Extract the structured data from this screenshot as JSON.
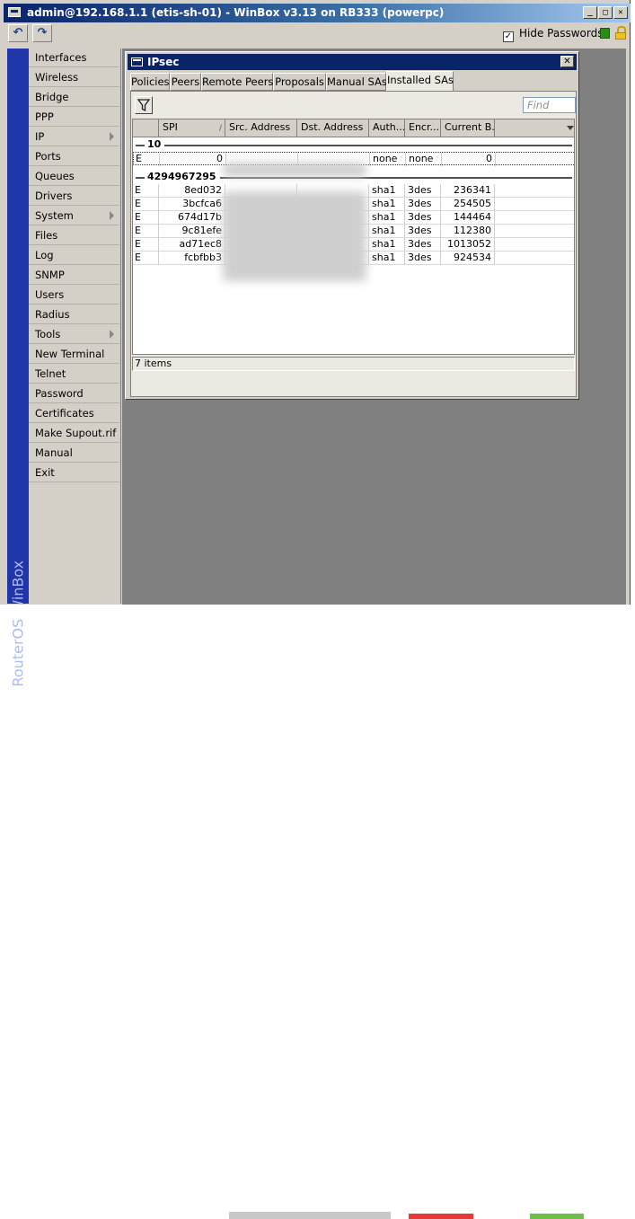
{
  "window": {
    "title": "admin@192.168.1.1 (etis-sh-01) - WinBox v3.13 on RB333 (powerpc)"
  },
  "toolbar": {
    "hide_passwords_label": "Hide Passwords",
    "hide_passwords_checked": "✓"
  },
  "brand": "RouterOS WinBox",
  "menu": {
    "items": [
      {
        "label": "Interfaces",
        "submenu": false
      },
      {
        "label": "Wireless",
        "submenu": false
      },
      {
        "label": "Bridge",
        "submenu": false
      },
      {
        "label": "PPP",
        "submenu": false
      },
      {
        "label": "IP",
        "submenu": true
      },
      {
        "label": "Ports",
        "submenu": false
      },
      {
        "label": "Queues",
        "submenu": false
      },
      {
        "label": "Drivers",
        "submenu": false
      },
      {
        "label": "System",
        "submenu": true
      },
      {
        "label": "Files",
        "submenu": false
      },
      {
        "label": "Log",
        "submenu": false
      },
      {
        "label": "SNMP",
        "submenu": false
      },
      {
        "label": "Users",
        "submenu": false
      },
      {
        "label": "Radius",
        "submenu": false
      },
      {
        "label": "Tools",
        "submenu": true
      },
      {
        "label": "New Terminal",
        "submenu": false
      },
      {
        "label": "Telnet",
        "submenu": false
      },
      {
        "label": "Password",
        "submenu": false
      },
      {
        "label": "Certificates",
        "submenu": false
      },
      {
        "label": "Make Supout.rif",
        "submenu": false
      },
      {
        "label": "Manual",
        "submenu": false
      },
      {
        "label": "Exit",
        "submenu": false
      }
    ]
  },
  "ipsec": {
    "title": "IPsec",
    "tabs": [
      "Policies",
      "Peers",
      "Remote Peers",
      "Proposals",
      "Manual SAs",
      "Installed SAs"
    ],
    "active_tab": "Installed SAs",
    "find_placeholder": "Find",
    "columns": [
      "",
      "SPI",
      "Src. Address",
      "Dst. Address",
      "Auth....",
      "Encr....",
      "Current B..."
    ],
    "groups": [
      {
        "name": "10",
        "rows": [
          {
            "flag": "E",
            "spi": "0",
            "src": "",
            "dst": "",
            "auth": "none",
            "enc": "none",
            "bytes": "0"
          }
        ]
      },
      {
        "name": "4294967295",
        "rows": [
          {
            "flag": "E",
            "spi": "8ed032",
            "src": "",
            "dst": "",
            "auth": "sha1",
            "enc": "3des",
            "bytes": "236341"
          },
          {
            "flag": "E",
            "spi": "3bcfca6",
            "src": "",
            "dst": "",
            "auth": "sha1",
            "enc": "3des",
            "bytes": "254505"
          },
          {
            "flag": "E",
            "spi": "674d17b",
            "src": "",
            "dst": "",
            "auth": "sha1",
            "enc": "3des",
            "bytes": "144464"
          },
          {
            "flag": "E",
            "spi": "9c81efe",
            "src": "",
            "dst": "",
            "auth": "sha1",
            "enc": "3des",
            "bytes": "112380"
          },
          {
            "flag": "E",
            "spi": "ad71ec8",
            "src": "",
            "dst": "",
            "auth": "sha1",
            "enc": "3des",
            "bytes": "1013052"
          },
          {
            "flag": "E",
            "spi": "fcbfbb3",
            "src": "",
            "dst": "",
            "auth": "sha1",
            "enc": "3des",
            "bytes": "924534"
          }
        ]
      }
    ],
    "status": "7 items"
  }
}
